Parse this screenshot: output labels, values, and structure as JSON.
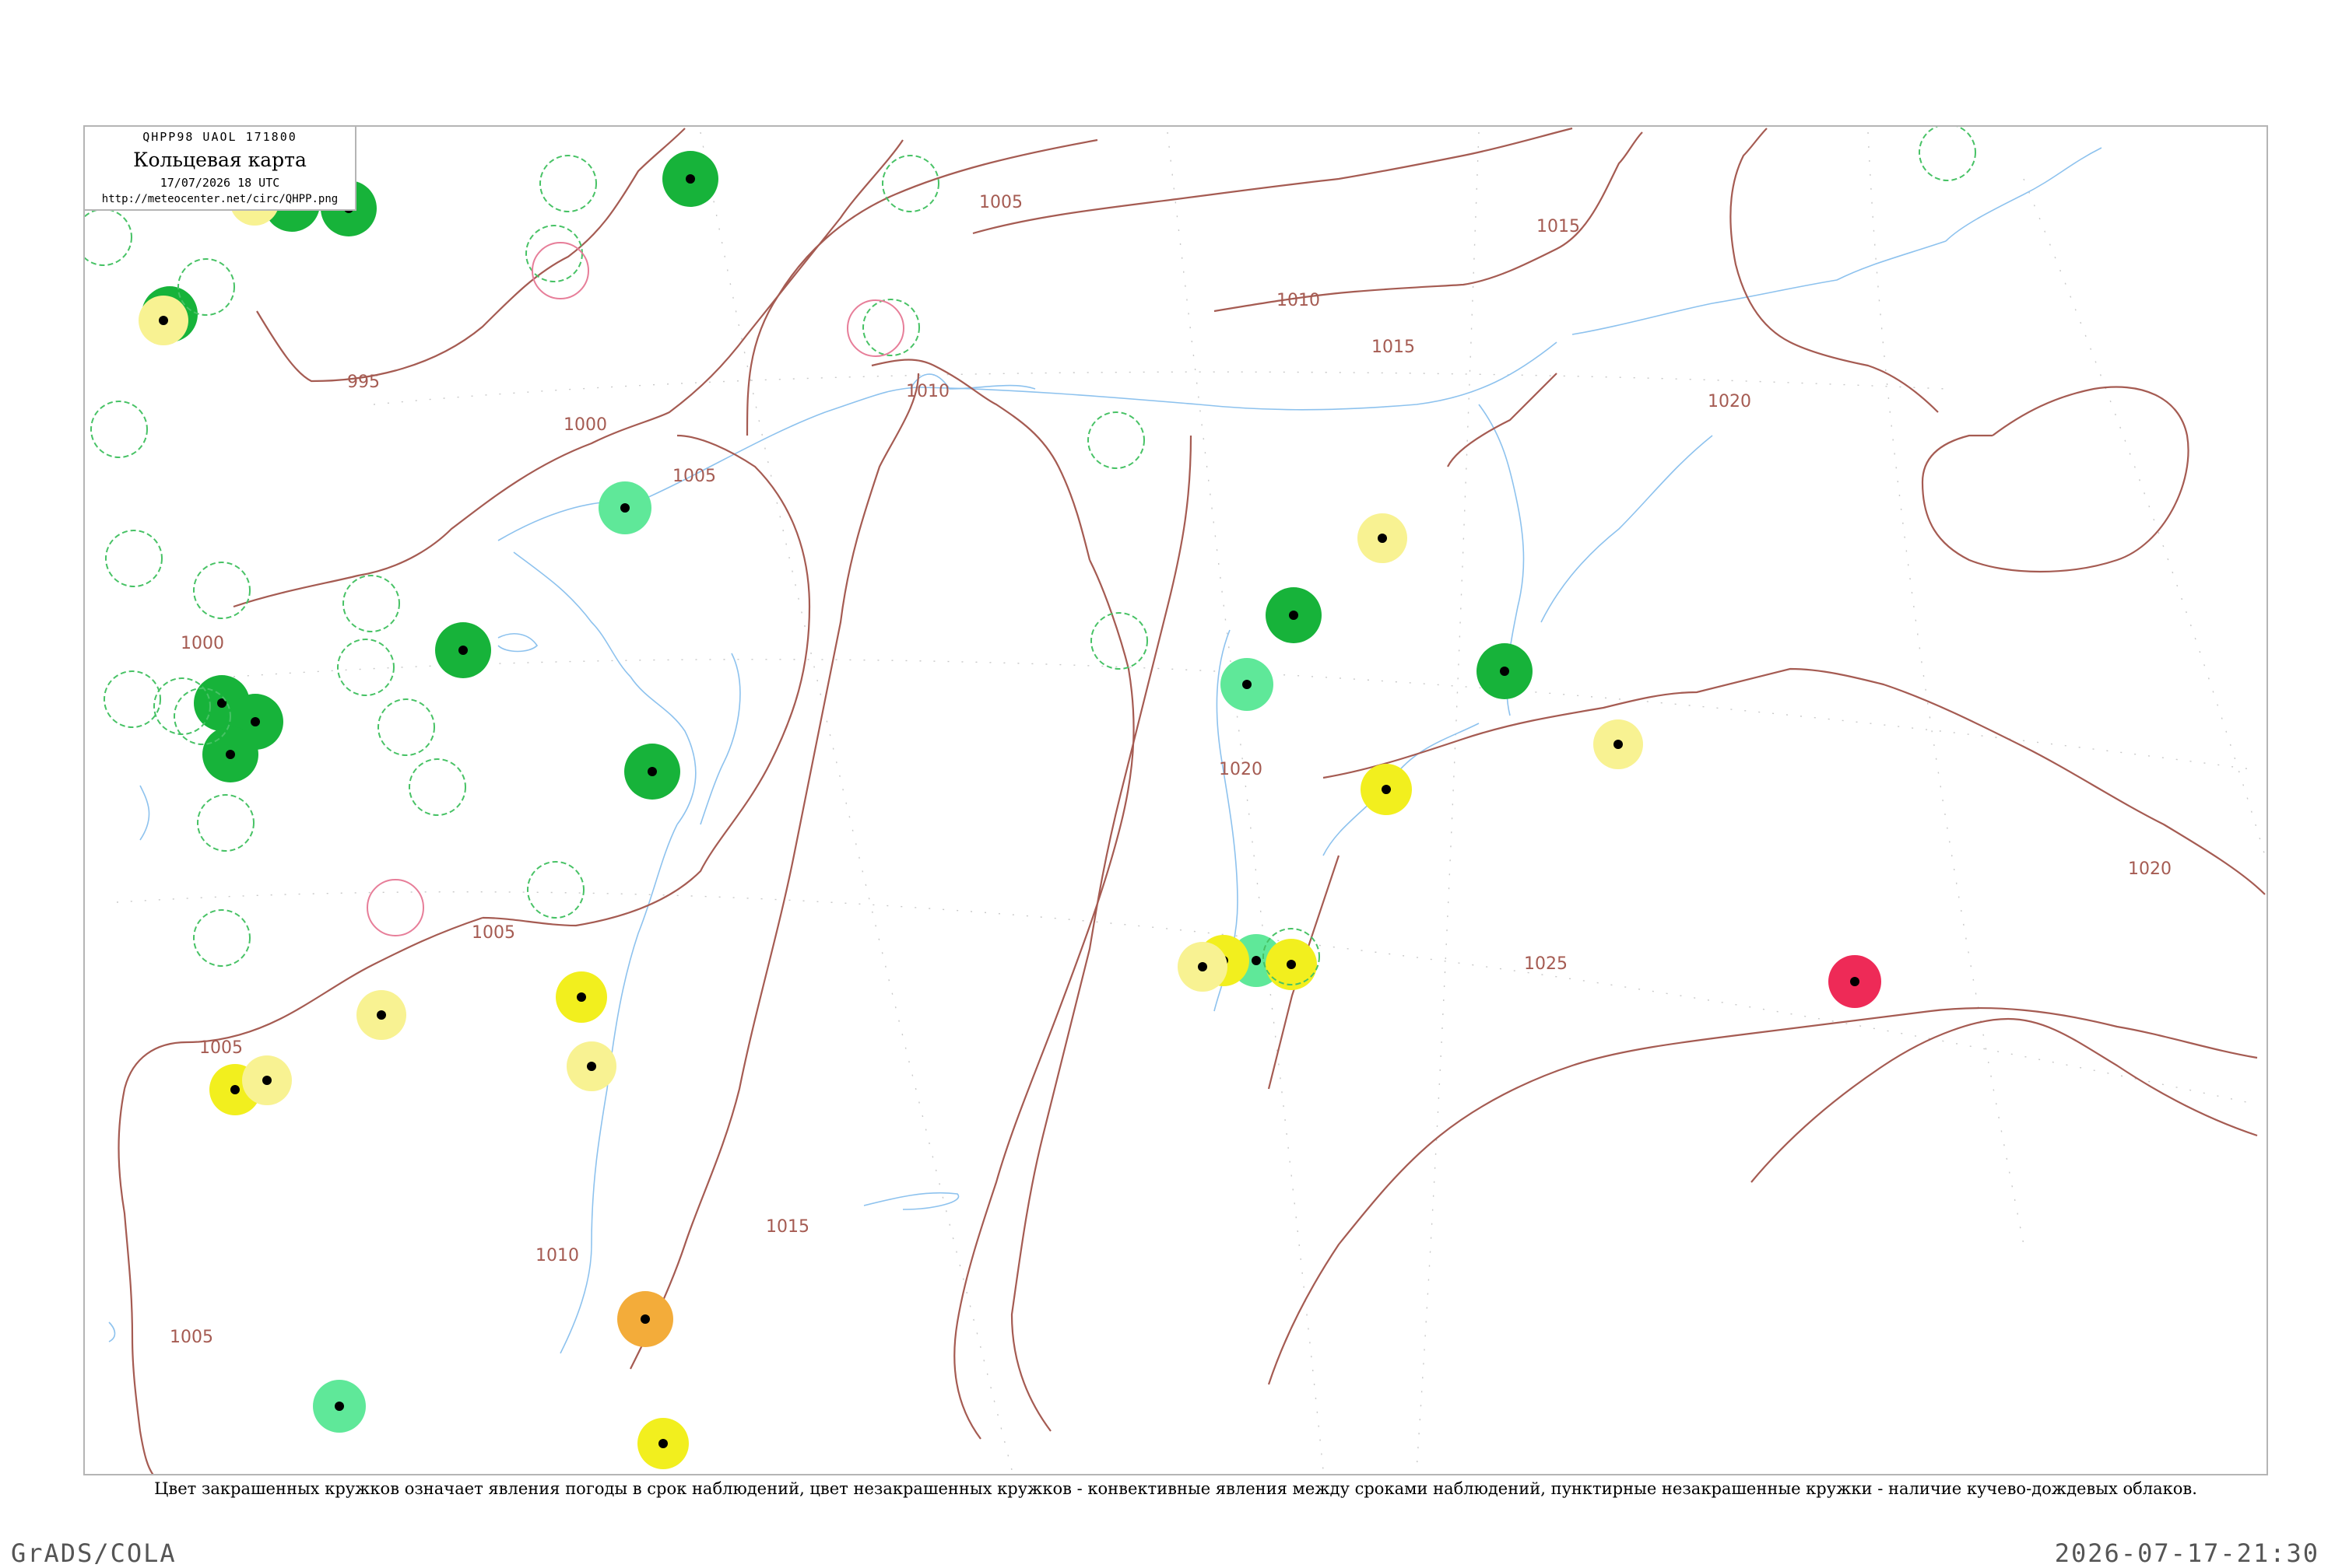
{
  "header": {
    "code": "QHPP98  UAOL  171800",
    "title": "Кольцевая карта",
    "time": "17/07/2026 18 UTC",
    "url": "http://meteocenter.net/circ/QHPP.png"
  },
  "caption": "Цвет закрашенных кружков означает явления погоды в срок наблюдений, цвет незакрашенных кружков - конвективные явления между сроками наблюдений, пунктирные незакрашенные кружки - наличие кучево-дождевых облаков.",
  "footer": {
    "left": "GrADS/COLA",
    "right": "2026-07-17-21:30"
  },
  "colors": {
    "isobar": "#a55b52",
    "water": "#8dc2ee",
    "frame": "#b5b5b5",
    "green_dark": "#17b33a",
    "green_light": "#5fe899",
    "yellow": "#f2ef1e",
    "yellow_light": "#f8f292",
    "orange": "#f3ac3a",
    "red": "#ee2a57",
    "dashed_green": "#47c265",
    "pink": "#e77e99"
  },
  "isobars": [
    {
      "label": "995"
    },
    {
      "label": "1000"
    },
    {
      "label": "1000"
    },
    {
      "label": "1005"
    },
    {
      "label": "1005"
    },
    {
      "label": "1005"
    },
    {
      "label": "1005"
    },
    {
      "label": "1005"
    },
    {
      "label": "1010"
    },
    {
      "label": "1010"
    },
    {
      "label": "1010"
    },
    {
      "label": "1015"
    },
    {
      "label": "1015"
    },
    {
      "label": "1015"
    },
    {
      "label": "1020"
    },
    {
      "label": "1020"
    },
    {
      "label": "1020"
    },
    {
      "label": "1025"
    }
  ],
  "station_markers": [
    {
      "fill": "green_dark"
    },
    {
      "fill": "green_dark"
    },
    {
      "fill": "green_dark"
    },
    {
      "fill": "green_dark"
    },
    {
      "fill": "green_dark"
    },
    {
      "fill": "green_dark"
    },
    {
      "fill": "green_dark"
    },
    {
      "fill": "green_dark"
    },
    {
      "fill": "green_dark"
    },
    {
      "fill": "green_dark"
    },
    {
      "fill": "green_dark"
    },
    {
      "fill": "green_light"
    },
    {
      "fill": "green_light"
    },
    {
      "fill": "green_light"
    },
    {
      "fill": "green_light"
    },
    {
      "fill": "yellow"
    },
    {
      "fill": "yellow"
    },
    {
      "fill": "yellow"
    },
    {
      "fill": "yellow"
    },
    {
      "fill": "yellow"
    },
    {
      "fill": "yellow"
    },
    {
      "fill": "yellow_light"
    },
    {
      "fill": "yellow_light"
    },
    {
      "fill": "yellow_light"
    },
    {
      "fill": "yellow_light"
    },
    {
      "fill": "yellow_light"
    },
    {
      "fill": "yellow_light"
    },
    {
      "fill": "yellow_light"
    },
    {
      "fill": "yellow_light"
    },
    {
      "fill": "orange"
    },
    {
      "fill": "red"
    },
    {
      "fill": "none",
      "ring": "dashed_green"
    },
    {
      "fill": "none",
      "ring": "dashed_green"
    },
    {
      "fill": "none",
      "ring": "dashed_green"
    },
    {
      "fill": "none",
      "ring": "dashed_green"
    },
    {
      "fill": "none",
      "ring": "dashed_green"
    },
    {
      "fill": "none",
      "ring": "dashed_green"
    },
    {
      "fill": "none",
      "ring": "dashed_green"
    },
    {
      "fill": "none",
      "ring": "dashed_green"
    },
    {
      "fill": "none",
      "ring": "dashed_green"
    },
    {
      "fill": "none",
      "ring": "dashed_green"
    },
    {
      "fill": "none",
      "ring": "dashed_green"
    },
    {
      "fill": "none",
      "ring": "dashed_green"
    },
    {
      "fill": "none",
      "ring": "dashed_green"
    },
    {
      "fill": "none",
      "ring": "dashed_green"
    },
    {
      "fill": "none",
      "ring": "dashed_green"
    },
    {
      "fill": "none",
      "ring": "dashed_green"
    },
    {
      "fill": "none",
      "ring": "dashed_green"
    },
    {
      "fill": "none",
      "ring": "dashed_green"
    },
    {
      "fill": "none",
      "ring": "dashed_green"
    },
    {
      "fill": "none",
      "ring": "dashed_green"
    },
    {
      "fill": "none",
      "ring": "dashed_green"
    },
    {
      "fill": "none",
      "ring": "dashed_green"
    },
    {
      "fill": "none",
      "ring": "dashed_green"
    },
    {
      "fill": "none",
      "ring": "pink"
    },
    {
      "fill": "none",
      "ring": "pink"
    },
    {
      "fill": "none",
      "ring": "pink"
    }
  ]
}
